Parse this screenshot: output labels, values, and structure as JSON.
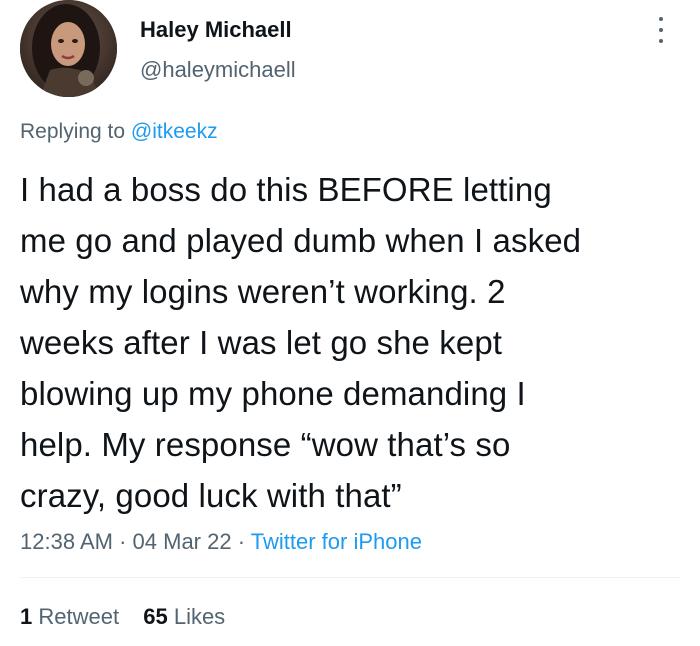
{
  "author": {
    "display_name": "Haley Michaell",
    "handle": "@haleymichaell"
  },
  "reply": {
    "prefix": "Replying to",
    "mention": "@itkeekz"
  },
  "tweet": {
    "text": "I had a boss do this BEFORE letting\nme go and played dumb when I asked\nwhy my logins weren’t working. 2\nweeks after I was let go she kept\nblowing up my phone demanding I\nhelp. My response “wow that’s so\ncrazy, good luck with that”"
  },
  "meta": {
    "time": "12:38 AM",
    "sep1": "·",
    "date": "04 Mar 22",
    "sep2": "·",
    "source": "Twitter for iPhone"
  },
  "stats": {
    "retweets_count": "1",
    "retweets_label": "Retweet",
    "likes_count": "65",
    "likes_label": "Likes"
  },
  "colors": {
    "accent": "#1d9bf0",
    "secondary_text": "#536471",
    "primary_text": "#0f1419"
  },
  "icons": {
    "more": "more-vertical-icon"
  }
}
